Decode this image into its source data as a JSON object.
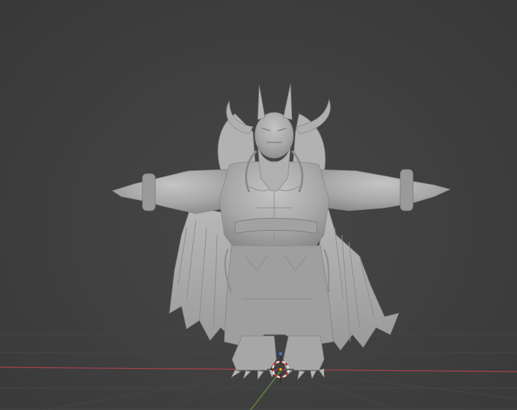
{
  "viewport": {
    "background_color": "#3d3d3d",
    "model_color": "#a6a6a6",
    "x_axis_color": "#b04050",
    "y_axis_color": "#6a9a3a",
    "cursor_colors": [
      "#e0e0e0",
      "#d03030"
    ],
    "object_origin_color": "#f0a020",
    "gizmo_color": "#4a7ad8"
  }
}
